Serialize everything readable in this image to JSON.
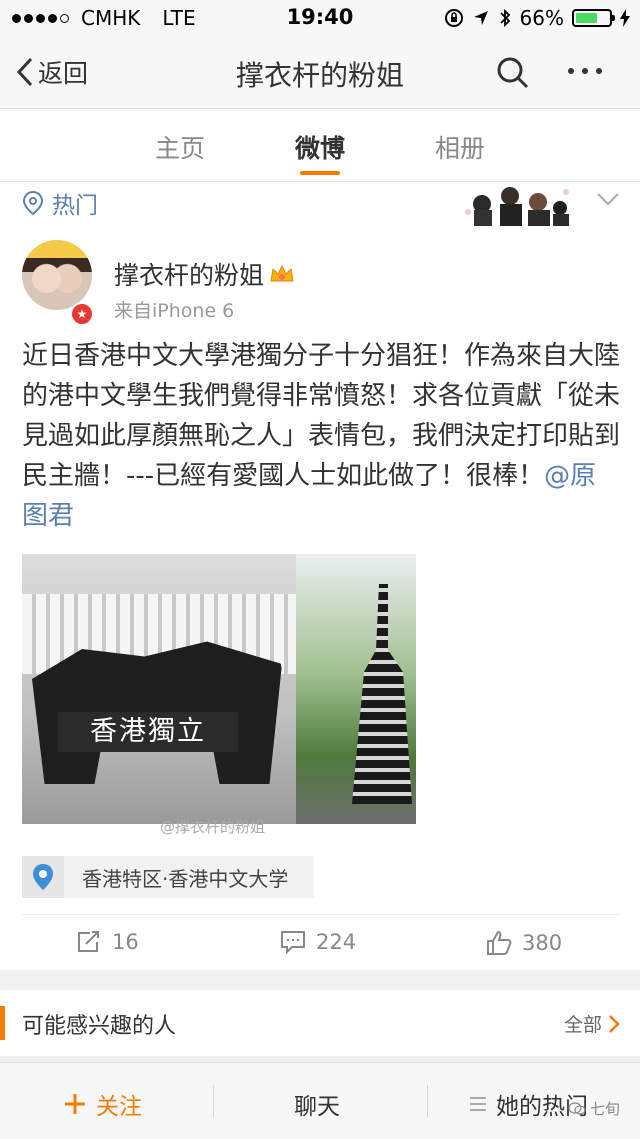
{
  "status_bar": {
    "carrier": "CMHK",
    "network": "LTE",
    "time": "19:40",
    "battery_percent": "66%",
    "battery_level": 0.66
  },
  "nav": {
    "back_label": "返回",
    "title": "撑衣杆的粉姐"
  },
  "tabs": [
    {
      "label": "主页",
      "active": false
    },
    {
      "label": "微博",
      "active": true
    },
    {
      "label": "相册",
      "active": false
    }
  ],
  "filter": {
    "label": "热门"
  },
  "post": {
    "username": "撑衣杆的粉姐",
    "source": "来自iPhone 6",
    "text": "近日香港中文大學港獨分子十分猖狂！作為來自大陸的港中文學生我們覺得非常憤怒！求各位貢獻「從未見過如此厚顏無恥之人」表情包，我們決定打印貼到民主牆！---已經有愛國人士如此做了！很棒！",
    "mention": "@原图君",
    "image": {
      "banner_text": "香港獨立",
      "watermark": "@撑衣杆的粉姐"
    },
    "location": "香港特区·香港中文大学",
    "reposts": "16",
    "comments": "224",
    "likes": "380"
  },
  "suggestions": {
    "title": "可能感兴趣的人",
    "all_label": "全部"
  },
  "bottom_bar": {
    "follow_label": "关注",
    "chat_label": "聊天",
    "hot_label": "她的热门"
  },
  "watermark": {
    "text": "七旬"
  },
  "colors": {
    "accent": "#f57c00",
    "link": "#5b7fb0",
    "battery": "#4cd964",
    "verified": "#e53935"
  },
  "icons": [
    "back-chevron-icon",
    "search-icon",
    "more-icon",
    "location-pin-icon",
    "repost-icon",
    "comment-icon",
    "like-icon",
    "chevron-right-icon",
    "plus-icon",
    "list-icon"
  ]
}
